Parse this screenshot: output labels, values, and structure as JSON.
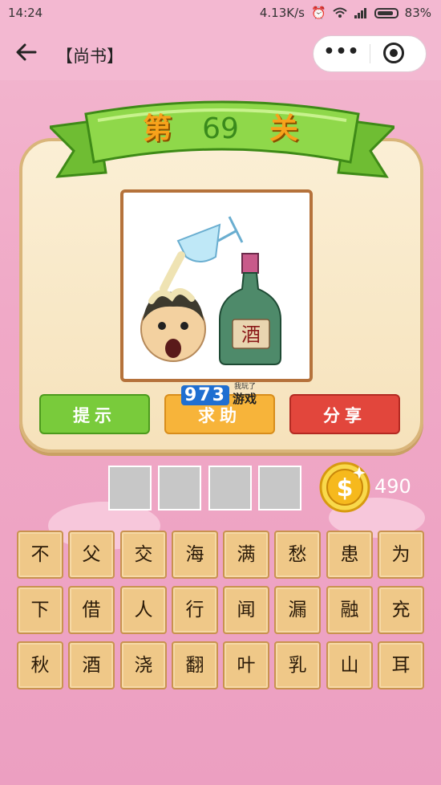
{
  "status_bar": {
    "time": "14:24",
    "network_speed": "4.13K/s",
    "battery": "83%"
  },
  "nav": {
    "title": "【尚书】",
    "more_label": "•••"
  },
  "level": {
    "prefix": "第",
    "number": "69",
    "suffix": "关"
  },
  "puzzle": {
    "bottle_label": "酒"
  },
  "buttons": {
    "hint": "提示",
    "help": "求助",
    "share": "分享"
  },
  "watermark": {
    "digits": "973",
    "text": "游戏",
    "small": "我玩了"
  },
  "answer_slots": [
    "",
    "",
    "",
    ""
  ],
  "coins": {
    "count": "490"
  },
  "characters": [
    [
      "不",
      "父",
      "交",
      "海",
      "满",
      "愁",
      "患",
      "为"
    ],
    [
      "下",
      "借",
      "人",
      "行",
      "闻",
      "漏",
      "融",
      "充"
    ],
    [
      "秋",
      "酒",
      "浇",
      "翻",
      "叶",
      "乳",
      "山",
      "耳"
    ]
  ],
  "colors": {
    "hint": "#79cb3b",
    "help": "#f7b43a",
    "share": "#e2463c",
    "ribbon": "#8fd84a"
  }
}
